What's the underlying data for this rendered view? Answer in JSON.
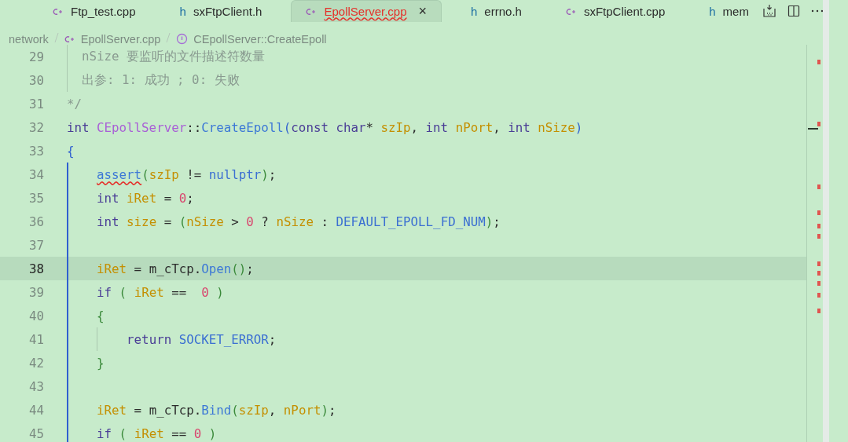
{
  "tabs": [
    {
      "label": "Ftp_test.cpp",
      "kind": "cpp",
      "selected": false,
      "error": false
    },
    {
      "label": "sxFtpClient.h",
      "kind": "header",
      "icon_label": "h",
      "selected": false,
      "error": false
    },
    {
      "label": "EpollServer.cpp",
      "kind": "cpp",
      "selected": true,
      "error": true,
      "close": "×"
    },
    {
      "label": "errno.h",
      "kind": "header",
      "icon_label": "h",
      "selected": false,
      "error": false
    },
    {
      "label": "sxFtpClient.cpp",
      "kind": "cpp",
      "selected": false,
      "error": false
    },
    {
      "label": "mem",
      "kind": "header",
      "icon_label": "h",
      "selected": false,
      "error": false
    }
  ],
  "breadcrumb": [
    {
      "label": "network"
    },
    {
      "label": "EpollServer.cpp",
      "kind": "cpp"
    },
    {
      "label": "CEpollServer::CreateEpoll",
      "kind": "symbol"
    }
  ],
  "lines": [
    {
      "number": "29",
      "current": false,
      "active_scope": false,
      "tokens": [
        {
          "kind": "comment",
          "text": "  nSize 要监听的文件描述符数量"
        }
      ]
    },
    {
      "number": "30",
      "current": false,
      "active_scope": false,
      "tokens": [
        {
          "kind": "comment",
          "text": "  出参: 1: 成功 ; 0: 失败"
        }
      ]
    },
    {
      "number": "31",
      "current": false,
      "active_scope": false,
      "tokens": [
        {
          "kind": "comment",
          "text": "*/"
        }
      ]
    },
    {
      "number": "32",
      "current": false,
      "active_scope": false,
      "tokens": [
        {
          "kind": "keyword",
          "text": "int "
        },
        {
          "kind": "class",
          "text": "CEpollServer"
        },
        {
          "kind": "plain",
          "text": "::"
        },
        {
          "kind": "func",
          "text": "CreateEpoll"
        },
        {
          "kind": "bracket1",
          "text": "("
        },
        {
          "kind": "keyword",
          "text": "const char"
        },
        {
          "kind": "plain",
          "text": "* "
        },
        {
          "kind": "var",
          "text": "szIp"
        },
        {
          "kind": "plain",
          "text": ", "
        },
        {
          "kind": "keyword",
          "text": "int "
        },
        {
          "kind": "var",
          "text": "nPort"
        },
        {
          "kind": "plain",
          "text": ", "
        },
        {
          "kind": "keyword",
          "text": "int "
        },
        {
          "kind": "var",
          "text": "nSize"
        },
        {
          "kind": "bracket1",
          "text": ")"
        }
      ]
    },
    {
      "number": "33",
      "current": false,
      "active_scope": false,
      "tokens": [
        {
          "kind": "bracket1",
          "text": "{"
        }
      ]
    },
    {
      "number": "34",
      "current": false,
      "active_scope": true,
      "tokens": [
        {
          "kind": "func",
          "text": "    assert",
          "squiggle": true
        },
        {
          "kind": "bracket2",
          "text": "("
        },
        {
          "kind": "var",
          "text": "szIp"
        },
        {
          "kind": "plain",
          "text": " != "
        },
        {
          "kind": "macro",
          "text": "nullptr"
        },
        {
          "kind": "bracket2",
          "text": ")"
        },
        {
          "kind": "plain",
          "text": ";"
        }
      ]
    },
    {
      "number": "35",
      "current": false,
      "active_scope": true,
      "tokens": [
        {
          "kind": "keyword",
          "text": "    int "
        },
        {
          "kind": "var",
          "text": "iRet"
        },
        {
          "kind": "plain",
          "text": " = "
        },
        {
          "kind": "number",
          "text": "0"
        },
        {
          "kind": "plain",
          "text": ";"
        }
      ]
    },
    {
      "number": "36",
      "current": false,
      "active_scope": true,
      "tokens": [
        {
          "kind": "keyword",
          "text": "    int "
        },
        {
          "kind": "var",
          "text": "size"
        },
        {
          "kind": "plain",
          "text": " = "
        },
        {
          "kind": "bracket2",
          "text": "("
        },
        {
          "kind": "var",
          "text": "nSize"
        },
        {
          "kind": "plain",
          "text": " > "
        },
        {
          "kind": "number",
          "text": "0"
        },
        {
          "kind": "plain",
          "text": " ? "
        },
        {
          "kind": "var",
          "text": "nSize"
        },
        {
          "kind": "plain",
          "text": " : "
        },
        {
          "kind": "macro",
          "text": "DEFAULT_EPOLL_FD_NUM"
        },
        {
          "kind": "bracket2",
          "text": ")"
        },
        {
          "kind": "plain",
          "text": ";"
        }
      ]
    },
    {
      "number": "37",
      "current": false,
      "active_scope": true
    },
    {
      "number": "38",
      "current": true,
      "active_scope": true,
      "tokens": [
        {
          "kind": "var",
          "text": "    iRet"
        },
        {
          "kind": "plain",
          "text": " = m_cTcp."
        },
        {
          "kind": "func",
          "text": "Open"
        },
        {
          "kind": "bracket2",
          "text": "()"
        },
        {
          "kind": "plain",
          "text": ";"
        }
      ]
    },
    {
      "number": "39",
      "current": false,
      "active_scope": true,
      "tokens": [
        {
          "kind": "keyword",
          "text": "    if "
        },
        {
          "kind": "bracket2",
          "text": "( "
        },
        {
          "kind": "var",
          "text": "iRet"
        },
        {
          "kind": "plain",
          "text": " ==  "
        },
        {
          "kind": "number",
          "text": "0"
        },
        {
          "kind": "bracket2",
          "text": " )"
        }
      ]
    },
    {
      "number": "40",
      "current": false,
      "active_scope": true,
      "tokens": [
        {
          "kind": "bracket2",
          "text": "    {"
        }
      ]
    },
    {
      "number": "41",
      "current": false,
      "active_scope": true,
      "tokens": [
        {
          "kind": "keyword",
          "text": "        return "
        },
        {
          "kind": "macro",
          "text": "SOCKET_ERROR"
        },
        {
          "kind": "plain",
          "text": ";"
        }
      ]
    },
    {
      "number": "42",
      "current": false,
      "active_scope": true,
      "tokens": [
        {
          "kind": "bracket2",
          "text": "    }"
        }
      ]
    },
    {
      "number": "43",
      "current": false,
      "active_scope": true
    },
    {
      "number": "44",
      "current": false,
      "active_scope": true,
      "tokens": [
        {
          "kind": "var",
          "text": "    iRet"
        },
        {
          "kind": "plain",
          "text": " = m_cTcp."
        },
        {
          "kind": "func",
          "text": "Bind"
        },
        {
          "kind": "bracket2",
          "text": "("
        },
        {
          "kind": "var",
          "text": "szIp"
        },
        {
          "kind": "plain",
          "text": ", "
        },
        {
          "kind": "var",
          "text": "nPort"
        },
        {
          "kind": "bracket2",
          "text": ")"
        },
        {
          "kind": "plain",
          "text": ";"
        }
      ]
    },
    {
      "number": "45",
      "current": false,
      "active_scope": true,
      "tokens": [
        {
          "kind": "keyword",
          "text": "    if "
        },
        {
          "kind": "bracket2",
          "text": "( "
        },
        {
          "kind": "var",
          "text": "iRet"
        },
        {
          "kind": "plain",
          "text": " == "
        },
        {
          "kind": "number",
          "text": "0"
        },
        {
          "kind": "bracket2",
          "text": " )"
        }
      ]
    }
  ]
}
